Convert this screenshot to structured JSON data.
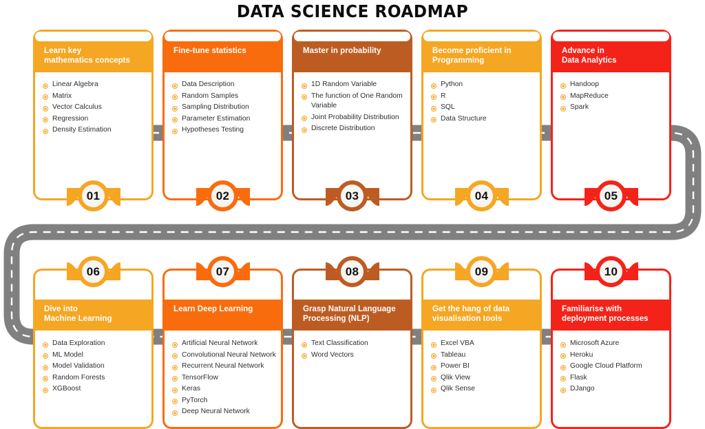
{
  "title": "DATA SCIENCE ROADMAP",
  "colors": {
    "amber": "#F5A623",
    "orange": "#F96C0D",
    "burnt": "#BD5C22",
    "red": "#F42319",
    "road": "#808080",
    "road_dash": "#FFFFFF",
    "badge_face": "#F7F5F2",
    "bullet": "#F5A623",
    "body_text": "#2E2E2E",
    "header_text": "#FFFFFF",
    "background": "#FFFFFF"
  },
  "road": {
    "label": "dashed-road-connector",
    "style": "gray band with white dashed center line, routes behind cards left-to-right on row one, loops around right edge down to row two, loops around left edge at the end"
  },
  "cards": [
    {
      "number": "01",
      "color": "#F5A623",
      "row": "top",
      "heading": "Learn key\nmathematics concepts",
      "items": [
        "Linear Algebra",
        "Matrix",
        "Vector Calculus",
        "Regression",
        "Density Estimation"
      ]
    },
    {
      "number": "02",
      "color": "#F96C0D",
      "row": "top",
      "heading": "Fine-tune statistics",
      "items": [
        "Data Description",
        "Random Samples",
        "Sampling Distribution",
        "Parameter Estimation",
        "Hypotheses Testing"
      ]
    },
    {
      "number": "03",
      "color": "#BD5C22",
      "row": "top",
      "heading": "Master in probability",
      "items": [
        "1D Random Variable",
        "The function of One Random Variable",
        "Joint Probability Distribution",
        "Discrete Distribution"
      ]
    },
    {
      "number": "04",
      "color": "#F5A623",
      "row": "top",
      "heading": "Become proficient in\nProgramming",
      "items": [
        "Python",
        "R",
        "SQL",
        "Data Structure"
      ]
    },
    {
      "number": "05",
      "color": "#F42319",
      "row": "top",
      "heading": "Advance in\nData Analytics",
      "items": [
        "Handoop",
        "MapReduce",
        "Spark"
      ]
    },
    {
      "number": "06",
      "color": "#F5A623",
      "row": "bottom",
      "heading": "Dive into\nMachine Learning",
      "items": [
        "Data Exploration",
        "ML Model",
        "Model Validation",
        "Random Forests",
        "XGBoost"
      ]
    },
    {
      "number": "07",
      "color": "#F96C0D",
      "row": "bottom",
      "heading": "Learn Deep Learning",
      "items": [
        "Artificial Neural Network",
        "Convolutional Neural Network",
        "Recurrent Neural Network",
        "TensorFlow",
        "Keras",
        "PyTorch",
        "Deep Neural Network"
      ]
    },
    {
      "number": "08",
      "color": "#BD5C22",
      "row": "bottom",
      "heading": "Grasp Natural Language\nProcessing (NLP)",
      "items": [
        "Text Classification",
        "Word Vectors"
      ]
    },
    {
      "number": "09",
      "color": "#F5A623",
      "row": "bottom",
      "heading": "Get the hang of data\nvisualisation tools",
      "items": [
        "Excel VBA",
        "Tableau",
        "Power BI",
        "Qlik View",
        "Qlik Sense"
      ]
    },
    {
      "number": "10",
      "color": "#F42319",
      "row": "bottom",
      "heading": "Familiarise with\ndeployment processes",
      "items": [
        "Microsoft Azure",
        "Heroku",
        "Google Cloud Platform",
        "Flask",
        "DJango"
      ]
    }
  ]
}
